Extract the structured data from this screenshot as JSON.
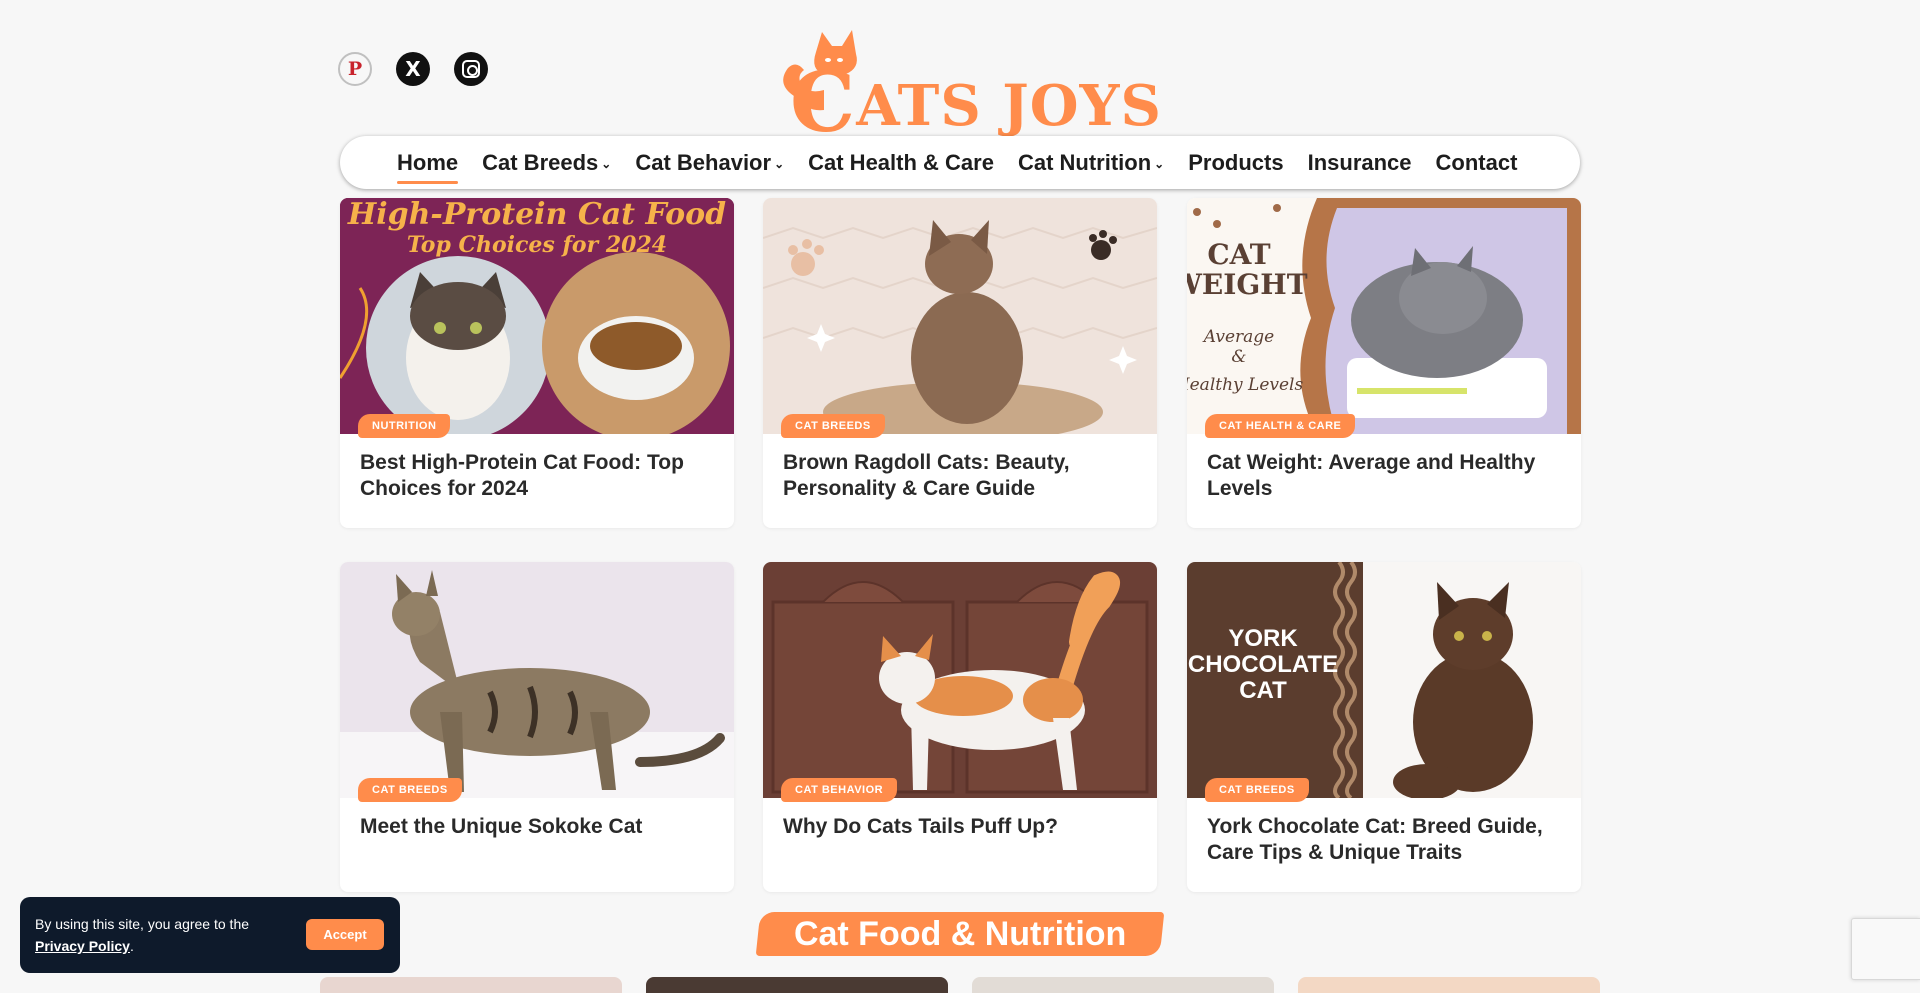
{
  "site": {
    "logo_text": "ATS JOYS",
    "logo_initial": "C"
  },
  "social": [
    {
      "name": "pinterest-icon",
      "glyph": "P"
    },
    {
      "name": "x-icon",
      "glyph": "X"
    },
    {
      "name": "instagram-icon",
      "glyph": ""
    }
  ],
  "nav": {
    "items": [
      {
        "label": "Home",
        "active": true,
        "dropdown": false
      },
      {
        "label": "Cat Breeds",
        "dropdown": true
      },
      {
        "label": "Cat Behavior",
        "dropdown": true
      },
      {
        "label": "Cat Health & Care",
        "dropdown": false
      },
      {
        "label": "Cat Nutrition",
        "dropdown": true
      },
      {
        "label": "Products",
        "dropdown": false
      },
      {
        "label": "Insurance",
        "dropdown": false
      },
      {
        "label": "Contact",
        "dropdown": false
      }
    ],
    "chevron": "⌄"
  },
  "cards": [
    {
      "category": "NUTRITION",
      "title": "Best High-Protein Cat Food: Top Choices for 2024",
      "image_text_1": "High-Protein Cat Food",
      "image_text_2": "Top Choices for 2024"
    },
    {
      "category": "CAT BREEDS",
      "title": "Brown Ragdoll Cats: Beauty, Personality & Care Guide"
    },
    {
      "category": "CAT HEALTH & CARE",
      "title": "Cat Weight: Average and Healthy Levels",
      "image_text_1": "CAT",
      "image_text_2": "WEIGHT",
      "image_text_3": "Average",
      "image_text_4": "&",
      "image_text_5": "Healthy Levels"
    },
    {
      "category": "CAT BREEDS",
      "title": "Meet the Unique Sokoke Cat"
    },
    {
      "category": "CAT BEHAVIOR",
      "title": "Why Do Cats Tails Puff Up?"
    },
    {
      "category": "CAT BREEDS",
      "title": "York Chocolate Cat: Breed Guide, Care Tips & Unique Traits",
      "image_text_1": "YORK",
      "image_text_2": "CHOCOLATE",
      "image_text_3": "CAT"
    }
  ],
  "section": {
    "heading": "Cat Food & Nutrition"
  },
  "cookie": {
    "message": "By using this site, you agree to the",
    "link": "Privacy Policy",
    "period": ".",
    "accept": "Accept"
  },
  "colors": {
    "accent": "#ff8c4b",
    "cookie_bg": "#0e1a2b",
    "page_bg": "#f7f7f7"
  }
}
